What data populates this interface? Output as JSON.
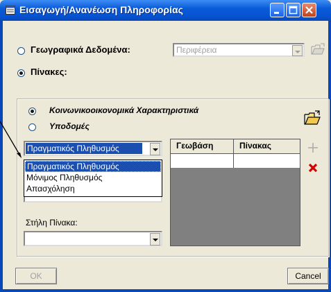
{
  "window": {
    "title": "Εισαγωγή/Ανανέωση Πληροφορίας"
  },
  "source": {
    "geo_label": "Γεωγραφικά Δεδομένα:",
    "geo_value": "Περιφέρεια",
    "tables_label": "Πίνακες:"
  },
  "tables": {
    "option_socio": "Κοινωνικοοικονομικά Χαρακτηριστικά",
    "option_infra": "Υποδομές",
    "combo_value": "Πραγματικός Πληθυσμός",
    "dropdown_items": [
      "Πραγματικός Πληθυσμός",
      "Μόνιμος Πληθυσμός",
      "Απασχόληση"
    ],
    "column_label": "Στήλη Πίνακα:",
    "column_value": ""
  },
  "grid": {
    "headers": [
      "Γεωβάση",
      "Πίνακας"
    ]
  },
  "buttons": {
    "ok": "OK",
    "cancel": "Cancel"
  },
  "colors": {
    "title_bar": "#0a5bd8",
    "window_face": "#ece9d8",
    "selection": "#1a4fb0",
    "delete_icon": "#d40000",
    "folder_icon": "#f2c94c"
  }
}
